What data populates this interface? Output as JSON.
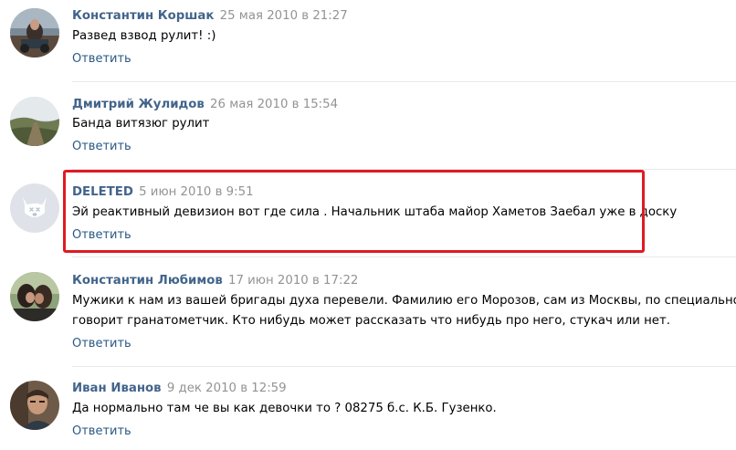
{
  "comments": [
    {
      "author": "Константин Коршак",
      "date": "25 мая 2010 в 21:27",
      "lines": [
        "Развед взвод рулит! :)"
      ],
      "reply_label": "Ответить",
      "avatar": "photo-avatar"
    },
    {
      "author": "Дмитрий Жулидов",
      "date": "26 мая 2010 в 15:54",
      "lines": [
        "Банда витязюг рулит"
      ],
      "reply_label": "Ответить",
      "avatar": "landscape-photo-avatar"
    },
    {
      "author": "DELETED",
      "date": "5 июн 2010 в 9:51",
      "lines": [
        "Эй реактивный девизион вот где сила . Начальник штаба майор Хаметов Заебал уже в доску"
      ],
      "reply_label": "Ответить",
      "avatar": "deleted-user-dog-avatar"
    },
    {
      "author": "Константин Любимов",
      "date": "17 июн 2010 в 17:22",
      "lines": [
        "Мужики к нам из вашей бригады духа перевели. Фамилию его Морозов, сам из Москвы, по специальности",
        "говорит гранатометчик. Кто нибудь может рассказать что нибудь про него, стукач или нет."
      ],
      "reply_label": "Ответить",
      "avatar": "couple-photo-avatar"
    },
    {
      "author": "Иван Иванов",
      "date": "9 дек 2010 в 12:59",
      "lines": [
        "Да нормально там че вы как девочки то ? 08275 б.с. К.Б. Гузенко."
      ],
      "reply_label": "Ответить",
      "avatar": "portrait-photo-avatar"
    }
  ],
  "colors": {
    "author_link": "#42648b",
    "date_text": "#939393",
    "reply_link": "#2a5885",
    "divider": "#e7e8ec",
    "highlight_border": "#e01a22",
    "deleted_avatar_bg": "#dfe3e9"
  }
}
